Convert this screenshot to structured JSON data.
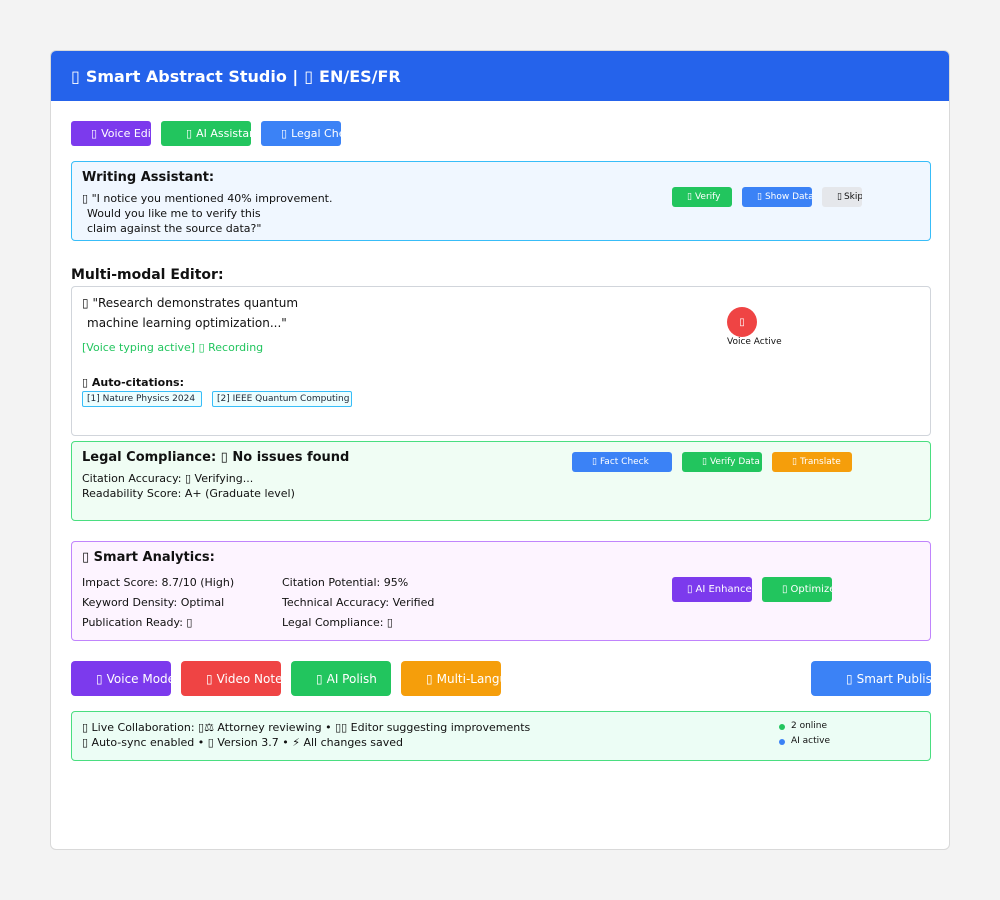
{
  "header": {
    "icon": "▯",
    "title": "Smart Abstract Studio |",
    "lang_icon": "▯",
    "languages": "EN/ES/FR"
  },
  "toolbar": {
    "buttons": [
      {
        "icon": "▯",
        "label": "Voice Edit",
        "color": "#7c3aed"
      },
      {
        "icon": "▯",
        "label": "AI Assistant",
        "color": "#22c55e"
      },
      {
        "icon": "▯",
        "label": "Legal Check",
        "color": "#3b82f6"
      }
    ]
  },
  "assistant": {
    "title": "Writing Assistant:",
    "icon": "▯",
    "message_lines": [
      "\"I notice you mentioned 40% improvement.",
      "Would you like me to verify this",
      "claim against the source data?\""
    ],
    "buttons": [
      {
        "icon": "▯",
        "label": "Verify",
        "color": "#22c55e"
      },
      {
        "icon": "▯",
        "label": "Show Data",
        "color": "#3b82f6"
      },
      {
        "icon": "▯",
        "label": "Skip",
        "color": "#e5e7eb"
      }
    ]
  },
  "editor": {
    "heading": "Multi-modal Editor:",
    "mic_icon": "▯",
    "text_lines": [
      "\"Research demonstrates quantum",
      "machine learning optimization...\""
    ],
    "voice_status": "[Voice typing active] ▯ Recording",
    "voice_indicator_icon": "▯",
    "voice_indicator_label": "Voice Active",
    "citations_icon": "▯",
    "citations_title": "Auto-citations:",
    "citations": [
      "[1] Nature Physics 2024",
      "[2] IEEE Quantum Computing"
    ]
  },
  "legal": {
    "title": "Legal Compliance: ▯ No issues found",
    "line1": "Citation Accuracy: ▯ Verifying...",
    "line2": "Readability Score: A+ (Graduate level)",
    "buttons": [
      {
        "icon": "▯",
        "label": "Fact Check",
        "color": "#3b82f6"
      },
      {
        "icon": "▯",
        "label": "Verify Data",
        "color": "#22c55e"
      },
      {
        "icon": "▯",
        "label": "Translate",
        "color": "#f59e0b"
      }
    ]
  },
  "analytics": {
    "title": "▯ Smart Analytics:",
    "left": [
      "Impact Score: 8.7/10 (High)",
      "Keyword Density: Optimal",
      "Publication Ready: ▯"
    ],
    "right": [
      "Citation Potential: 95%",
      "Technical Accuracy: Verified",
      "Legal Compliance: ▯"
    ],
    "buttons": [
      {
        "icon": "▯",
        "label": "AI Enhance",
        "color": "#7c3aed"
      },
      {
        "icon": "▯",
        "label": "Optimize",
        "color": "#22c55e"
      }
    ]
  },
  "actions": {
    "buttons": [
      {
        "icon": "▯",
        "label": "Voice Mode",
        "color": "#7c3aed"
      },
      {
        "icon": "▯",
        "label": "Video Notes",
        "color": "#ef4444"
      },
      {
        "icon": "▯",
        "label": "AI Polish",
        "color": "#22c55e"
      },
      {
        "icon": "▯",
        "label": "Multi-Language",
        "color": "#f59e0b"
      },
      {
        "icon": "▯",
        "label": "Smart Publish",
        "color": "#3b82f6"
      }
    ]
  },
  "collab": {
    "line1": "▯ Live Collaboration: ▯⚖ Attorney reviewing • ▯▯ Editor suggesting improvements",
    "line2": "▯ Auto-sync enabled • ▯ Version 3.7 • ⚡ All changes saved",
    "status": [
      {
        "label": "2 online",
        "color": "#22c55e"
      },
      {
        "label": "AI active",
        "color": "#3b82f6"
      }
    ]
  }
}
